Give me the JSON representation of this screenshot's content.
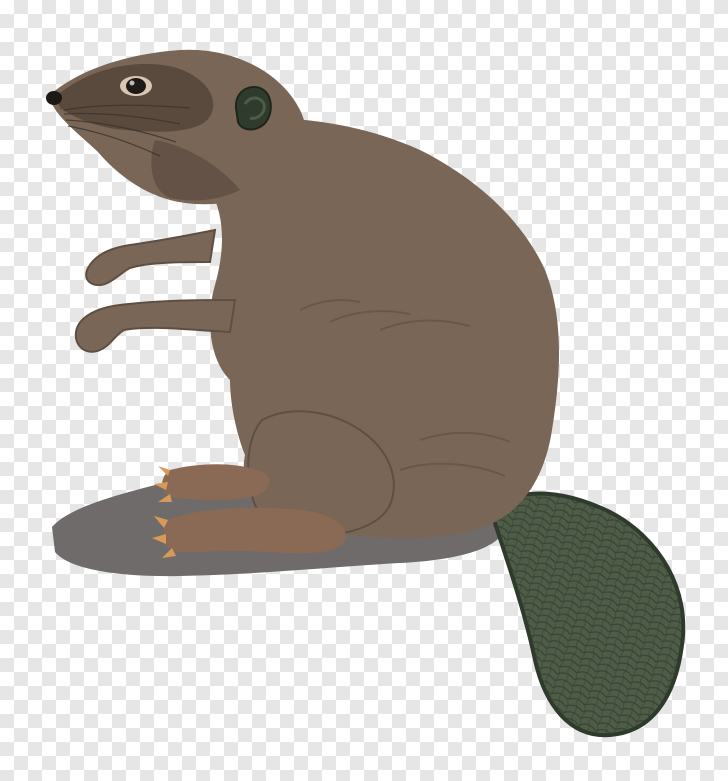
{
  "image": {
    "subject": "beaver",
    "background": "transparency-checkerboard",
    "colors": {
      "checker_light": "#ffffff",
      "checker_dark": "#e6e6e6",
      "fur": "#7a6656",
      "fur_shadow": "#5f4f42",
      "face_mask": "#5a4a3e",
      "feet": "#8b6a55",
      "claws": "#d79a58",
      "shadow": "#6f6b6b",
      "tail": "#4f5c47",
      "tail_scales": "#2f3b2d",
      "eye": "#1e1a18"
    }
  }
}
